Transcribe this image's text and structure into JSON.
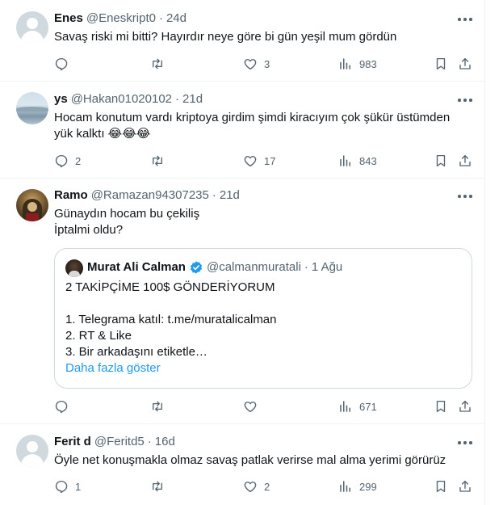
{
  "tweets": [
    {
      "name": "Enes",
      "handle": "@Eneskript0",
      "dot": "·",
      "time": "24d",
      "lines": [
        "Savaş riski mi bitti? Hayırdır neye göre bi gün yeşil mum gördün"
      ],
      "reply_count": "",
      "retweet_count": "",
      "like_count": "3",
      "view_count": "983"
    },
    {
      "name": "ys",
      "handle": "@Hakan01020102",
      "dot": "·",
      "time": "21d",
      "lines": [
        "Hocam konutum vardı kriptoya girdim şimdi kiracıyım çok şükür üstümden",
        "yük kalktı 😂😂😂"
      ],
      "reply_count": "2",
      "retweet_count": "",
      "like_count": "17",
      "view_count": "843"
    },
    {
      "name": "Ramo",
      "handle": "@Ramazan94307235",
      "dot": "·",
      "time": "21d",
      "lines": [
        "Günaydın hocam bu çekiliş",
        "İptalmi oldu?"
      ],
      "reply_count": "",
      "retweet_count": "",
      "like_count": "",
      "view_count": "671",
      "quote": {
        "name": "Murat Ali Calman",
        "handle": "@calmanmuratali",
        "dot": "·",
        "time": "1 Ağu",
        "lines": [
          "2 TAKİPÇİME 100$ GÖNDERİYORUM",
          "",
          "1. Telegrama katıl: t.me/muratalicalman",
          "2. RT & Like",
          "3. Bir arkadaşını etiketle…"
        ],
        "show_more": "Daha fazla göster"
      }
    },
    {
      "name": "Ferit d",
      "handle": "@Feritd5",
      "dot": "·",
      "time": "16d",
      "lines": [
        "Öyle net konuşmakla olmaz savaş patlak verirse mal alma yerimi görürüz"
      ],
      "reply_count": "1",
      "retweet_count": "",
      "like_count": "2",
      "view_count": "299"
    }
  ],
  "colors": {
    "text": "#0f1419",
    "secondary": "#536471",
    "link": "#1d9bf0",
    "verified": "#1d9bf0",
    "divider": "#eff3f4"
  },
  "icons": [
    "reply-icon",
    "retweet-icon",
    "like-icon",
    "views-icon",
    "bookmark-icon",
    "share-icon",
    "more-icon",
    "verified-badge-icon"
  ]
}
